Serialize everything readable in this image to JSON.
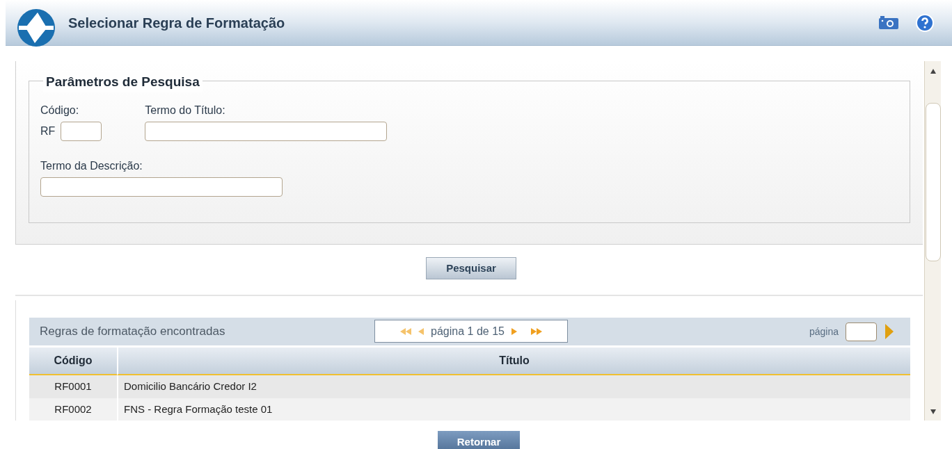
{
  "header": {
    "title": "Selecionar Regra de Formatação"
  },
  "search": {
    "legend": "Parâmetros de Pesquisa",
    "code_label": "Código:",
    "code_prefix": "RF",
    "title_label": "Termo do Título:",
    "description_label": "Termo da Descrição:",
    "button": "Pesquisar"
  },
  "results": {
    "title": "Regras de formatação encontradas",
    "pager": {
      "text": "página 1 de 15"
    },
    "goto_label": "página",
    "columns": [
      "Código",
      "Título"
    ],
    "rows": [
      {
        "code": "RF0001",
        "title": "Domicilio Bancário Credor I2"
      },
      {
        "code": "RF0002",
        "title": "FNS - Regra Formação teste 01"
      }
    ]
  },
  "footer": {
    "button": "Retornar"
  }
}
